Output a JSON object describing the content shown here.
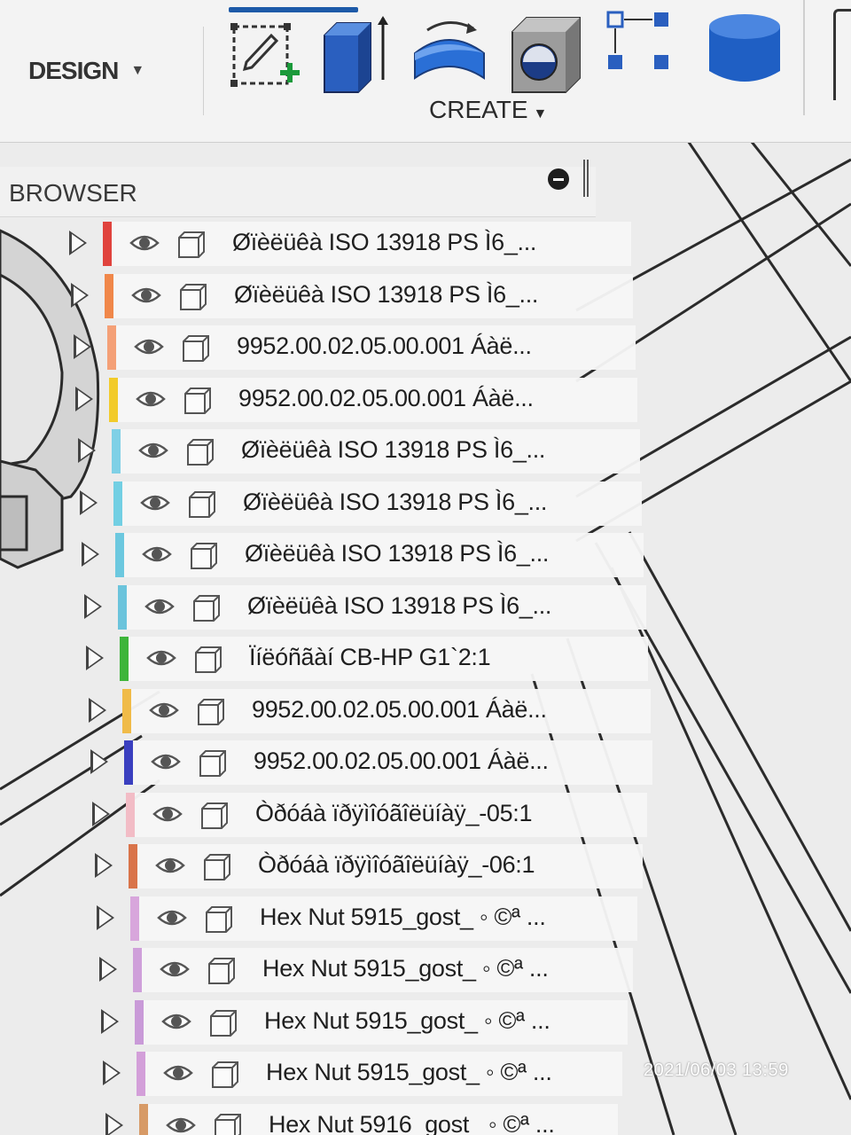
{
  "toolbar": {
    "workspace_label": "DESIGN",
    "create_label": "CREATE",
    "tools": [
      {
        "name": "create-sketch-icon"
      },
      {
        "name": "extrude-icon"
      },
      {
        "name": "revolve-icon"
      },
      {
        "name": "hole-icon"
      },
      {
        "name": "pattern-icon"
      },
      {
        "name": "cylinder-icon"
      }
    ]
  },
  "browser": {
    "title": "BROWSER",
    "items": [
      {
        "label": "Øïèëüêà ISO 13918 PS Ì6_...",
        "color": "#e0433d"
      },
      {
        "label": "Øïèëüêà ISO 13918 PS Ì6_...",
        "color": "#f0874a"
      },
      {
        "label": "9952.00.02.05.00.001 Áàë...",
        "color": "#f4a077"
      },
      {
        "label": "9952.00.02.05.00.001 Áàë...",
        "color": "#f2cb2a"
      },
      {
        "label": "Øïèëüêà ISO 13918 PS Ì6_...",
        "color": "#7fd0e6"
      },
      {
        "label": "Øïèëüêà ISO 13918 PS Ì6_...",
        "color": "#72cfe3"
      },
      {
        "label": "Øïèëüêà ISO 13918 PS Ì6_...",
        "color": "#6cc8df"
      },
      {
        "label": "Øïèëüêà ISO 13918 PS Ì6_...",
        "color": "#6bc4dc"
      },
      {
        "label": "Ïíëóñãàí CB-HP G1`2:1",
        "color": "#3db53a"
      },
      {
        "label": "9952.00.02.05.00.001 Áàë...",
        "color": "#f0bb48"
      },
      {
        "label": "9952.00.02.05.00.001 Áàë...",
        "color": "#3a3fbf"
      },
      {
        "label": "Òðóáà ïðÿìîóãîëüíàÿ_-05:1",
        "color": "#f2bcc6"
      },
      {
        "label": "Òðóáà ïðÿìîóãîëüíàÿ_-06:1",
        "color": "#d9744a"
      },
      {
        "label": "Hex Nut 5915_gost_ ◦ ©ª ...",
        "color": "#d8a6dc"
      },
      {
        "label": "Hex Nut 5915_gost_ ◦ ©ª ...",
        "color": "#cfa0da"
      },
      {
        "label": "Hex Nut 5915_gost_ ◦ ©ª ...",
        "color": "#c99ad8"
      },
      {
        "label": "Hex Nut 5915_gost_ ◦ ©ª ...",
        "color": "#d39fd9"
      },
      {
        "label": "Hex Nut 5916_gost_ ◦ ©ª ...",
        "color": "#d79a66"
      }
    ]
  },
  "timestamp": "2021/06/03 13:59"
}
